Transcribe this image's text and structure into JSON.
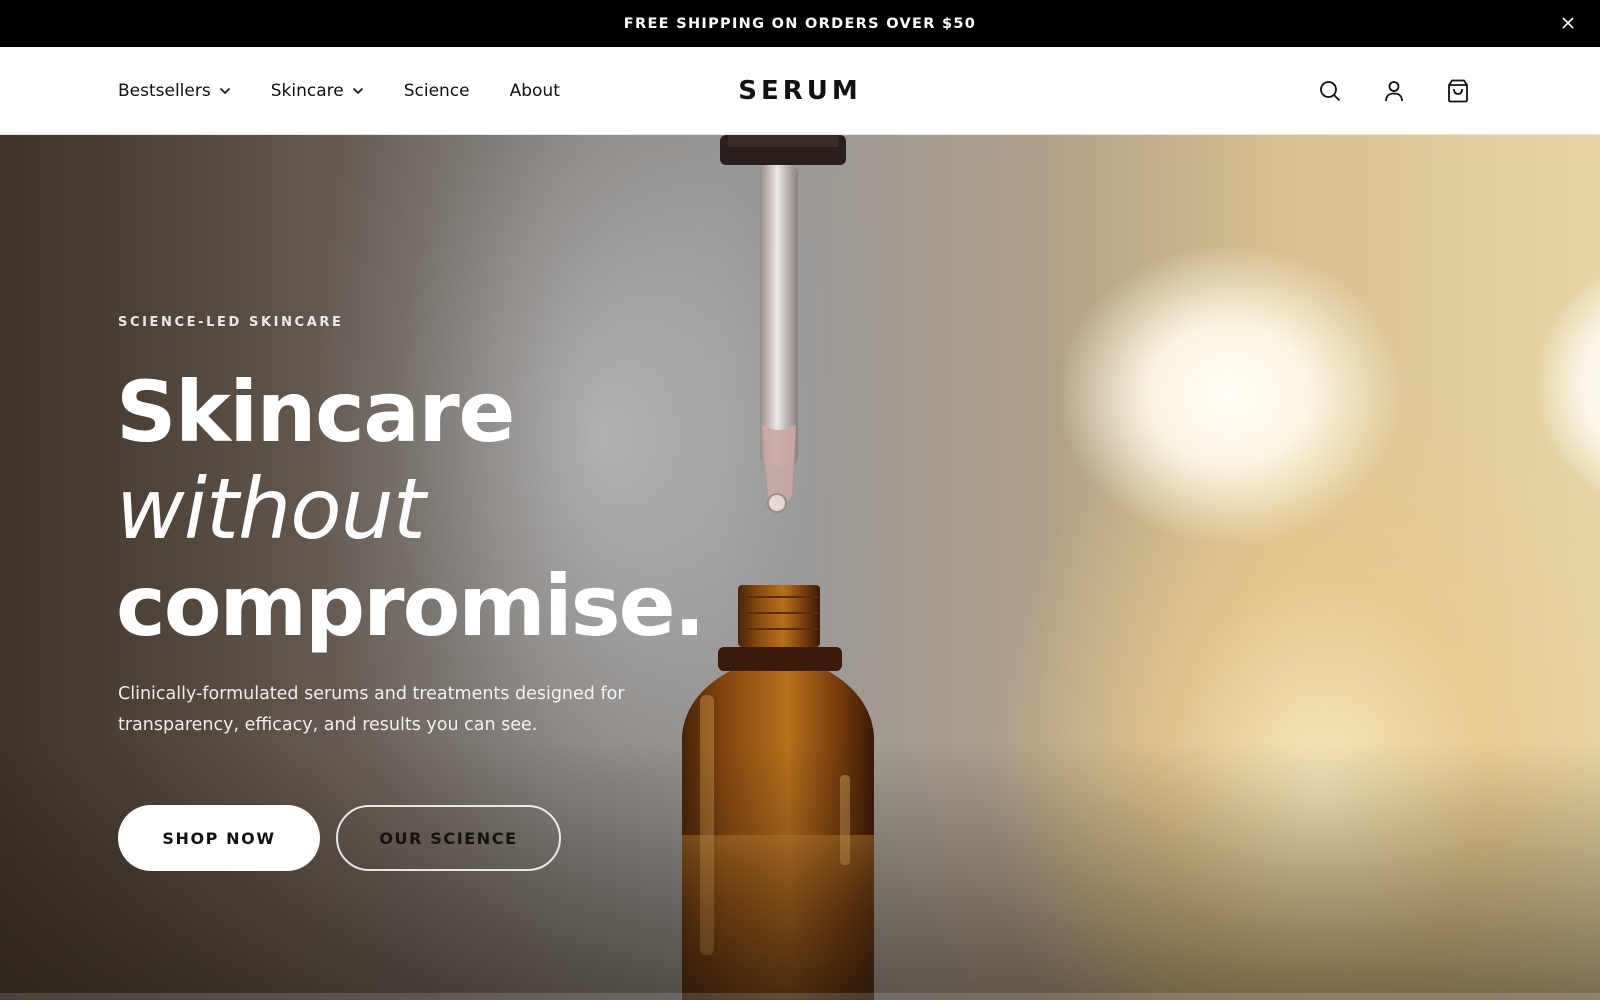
{
  "announcement": {
    "text": "FREE SHIPPING ON ORDERS OVER $50",
    "close_icon": "close-icon"
  },
  "header": {
    "logo": "SERUM",
    "nav": [
      {
        "label": "Bestsellers",
        "has_dropdown": true
      },
      {
        "label": "Skincare",
        "has_dropdown": true
      },
      {
        "label": "Science",
        "has_dropdown": false
      },
      {
        "label": "About",
        "has_dropdown": false
      }
    ],
    "icons": [
      "search-icon",
      "account-icon",
      "cart-icon"
    ]
  },
  "hero": {
    "eyebrow": "SCIENCE-LED SKINCARE",
    "headline_line1": "Skincare",
    "headline_line2": "without",
    "headline_line3": "compromise.",
    "subtext": "Clinically-formulated serums and treatments designed for transparency, efficacy, and results you can see.",
    "primary_button": "SHOP NOW",
    "secondary_button": "OUR SCIENCE"
  },
  "colors": {
    "announcement_bg": "#000000",
    "header_bg": "#ffffff",
    "text_dark": "#111111",
    "hero_text": "#ffffff",
    "bottle_amber": "#8a4a10"
  }
}
